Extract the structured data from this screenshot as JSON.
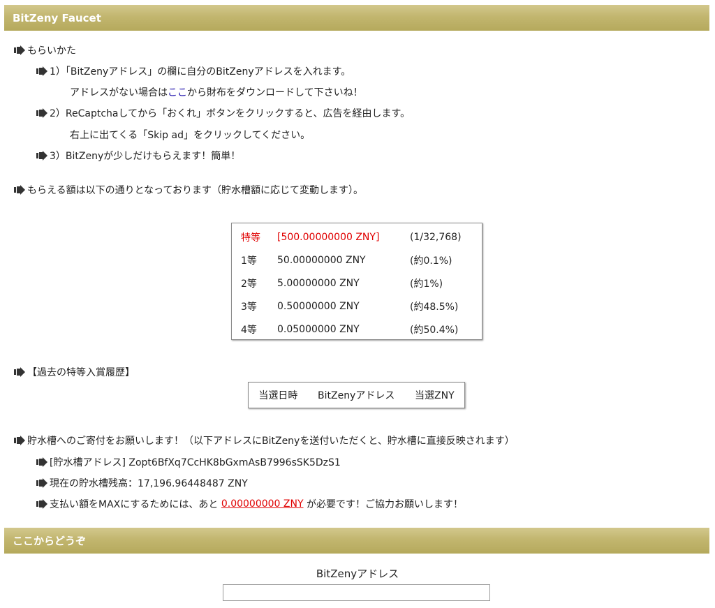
{
  "header": {
    "title": "BitZeny Faucet"
  },
  "howto": {
    "heading": "もらいかた",
    "step1": "1）「BitZenyアドレス」の欄に自分のBitZenyアドレスを入れます。",
    "step1_sub_before": "アドレスがない場合は",
    "step1_sub_link": "ここ",
    "step1_sub_after": "から財布をダウンロードして下さいね！",
    "step2": "2）ReCaptchaしてから「おくれ」ボタンをクリックすると、広告を経由します。",
    "step2_sub": "右上に出てくる「Skip ad」をクリックしてください。",
    "step3": "3）BitZenyが少しだけもらえます！簡単！"
  },
  "amount_intro": "もらえる額は以下の通りとなっております（貯水槽額に応じて変動します）。",
  "prizes": [
    {
      "rank": "特等",
      "amount": "[500.00000000 ZNY]",
      "odds": "(1/32,768)"
    },
    {
      "rank": "1等",
      "amount": "50.00000000 ZNY",
      "odds": "(約0.1%)"
    },
    {
      "rank": "2等",
      "amount": "5.00000000 ZNY",
      "odds": "(約1%)"
    },
    {
      "rank": "3等",
      "amount": "0.50000000 ZNY",
      "odds": "(約48.5%)"
    },
    {
      "rank": "4等",
      "amount": "0.05000000 ZNY",
      "odds": "(約50.4%)"
    }
  ],
  "history": {
    "heading": "【過去の特等入賞履歴】",
    "columns": [
      "当選日時",
      "BitZenyアドレス",
      "当選ZNY"
    ]
  },
  "donation": {
    "heading": "貯水槽へのご寄付をお願いします！（以下アドレスにBitZenyを送付いただくと、貯水槽に直接反映されます）",
    "address_line": "[貯水槽アドレス] Zopt6BfXq7CcHK8bGxmAsB7996sSK5DzS1",
    "balance_line": "現在の貯水槽残高：17,196.96448487 ZNY",
    "max_before": "支払い額をMAXにするためには、あと ",
    "max_amount": "0.00000000 ZNY",
    "max_after": " が必要です！ご協力お願いします！"
  },
  "section2": {
    "title": "ここからどうぞ"
  },
  "form": {
    "address_label": "BitZenyアドレス",
    "address_value": ""
  },
  "colors": {
    "header_bar": "#c2b66f",
    "accent_red": "#e00000",
    "link": "#1a0dab"
  }
}
